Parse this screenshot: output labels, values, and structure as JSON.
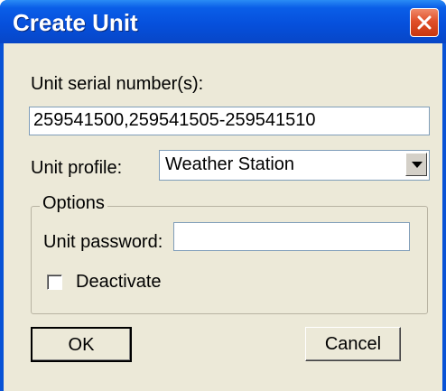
{
  "window": {
    "title": "Create Unit"
  },
  "form": {
    "serial_label": "Unit serial number(s):",
    "serial_value": "259541500,259541505-259541510",
    "profile_label": "Unit profile:",
    "profile_value": "Weather Station",
    "options": {
      "legend": "Options",
      "password_label": "Unit password:",
      "password_value": "",
      "deactivate_label": "Deactivate",
      "deactivate_checked": false
    }
  },
  "buttons": {
    "ok": "OK",
    "cancel": "Cancel"
  }
}
